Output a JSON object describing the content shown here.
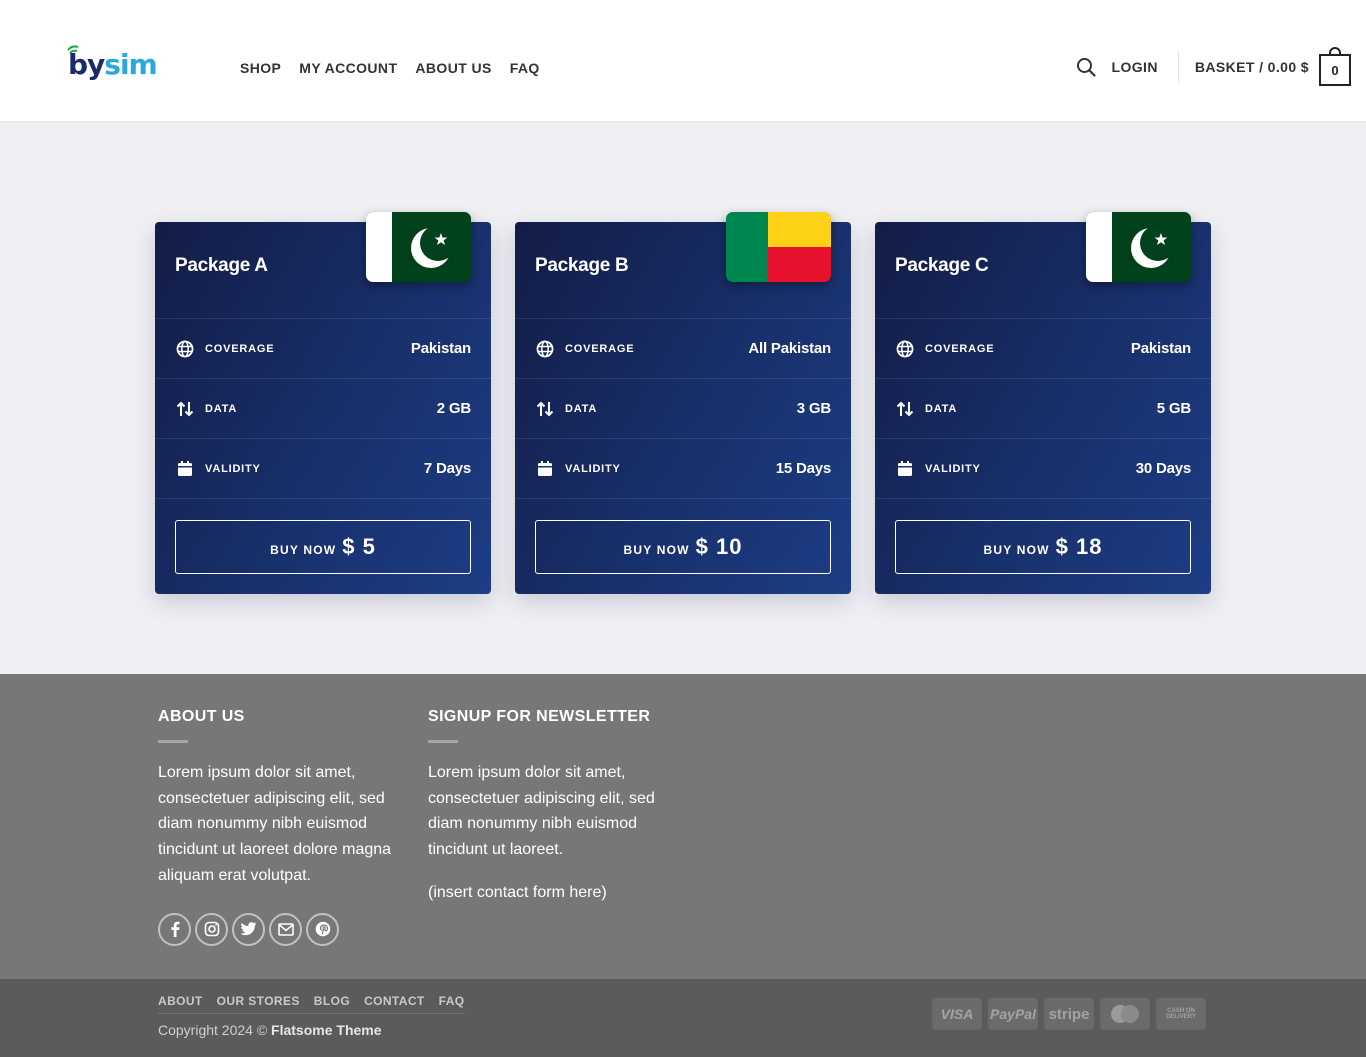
{
  "header": {
    "logo": {
      "part1": "by",
      "part2": "sim"
    },
    "nav": [
      "SHOP",
      "MY ACCOUNT",
      "ABOUT US",
      "FAQ"
    ],
    "login": "LOGIN",
    "basket": "BASKET / 0.00 $",
    "cart_count": "0"
  },
  "packages": [
    {
      "title": "Package A",
      "flag": "pakistan",
      "coverage_label": "COVERAGE",
      "coverage": "Pakistan",
      "data_label": "DATA",
      "data": "2 GB",
      "validity_label": "VALIDITY",
      "validity": "7 Days",
      "buy_label": "BUY NOW",
      "price": "$ 5"
    },
    {
      "title": "Package B",
      "flag": "benin",
      "coverage_label": "COVERAGE",
      "coverage": "All Pakistan",
      "data_label": "DATA",
      "data": "3 GB",
      "validity_label": "VALIDITY",
      "validity": "15 Days",
      "buy_label": "BUY NOW",
      "price": "$ 10"
    },
    {
      "title": "Package C",
      "flag": "pakistan",
      "coverage_label": "COVERAGE",
      "coverage": "Pakistan",
      "data_label": "DATA",
      "data": "5 GB",
      "validity_label": "VALIDITY",
      "validity": "30 Days",
      "buy_label": "BUY NOW",
      "price": "$ 18"
    }
  ],
  "footer": {
    "about": {
      "heading": "ABOUT US",
      "text": "Lorem ipsum dolor sit amet, consectetuer adipiscing elit, sed diam nonummy nibh euismod tincidunt ut laoreet dolore magna aliquam erat volutpat."
    },
    "newsletter": {
      "heading": "SIGNUP FOR NEWSLETTER",
      "text": "Lorem ipsum dolor sit amet, consectetuer adipiscing elit, sed diam nonummy nibh euismod tincidunt ut laoreet.",
      "note": "(insert contact form here)"
    },
    "social_icons": [
      "facebook-icon",
      "instagram-icon",
      "twitter-icon",
      "email-icon",
      "pinterest-icon"
    ]
  },
  "bottom": {
    "links": [
      "ABOUT",
      "OUR STORES",
      "BLOG",
      "CONTACT",
      "FAQ"
    ],
    "copyright_prefix": "Copyright 2024 © ",
    "copyright_brand": "Flatsome Theme",
    "payments": {
      "visa": "VISA",
      "paypal": "PayPal",
      "stripe": "stripe",
      "cod_line1": "CASH ON",
      "cod_line2": "DELIVERY"
    }
  },
  "colors": {
    "card_dark": "#131c46",
    "card_light": "#1d3d86",
    "pakistan_green": "#01411c",
    "benin_green": "#008751",
    "benin_yellow": "#fcd116",
    "benin_red": "#e8112d",
    "footer": "#777777",
    "bottom_bar": "#5b5b5b"
  }
}
